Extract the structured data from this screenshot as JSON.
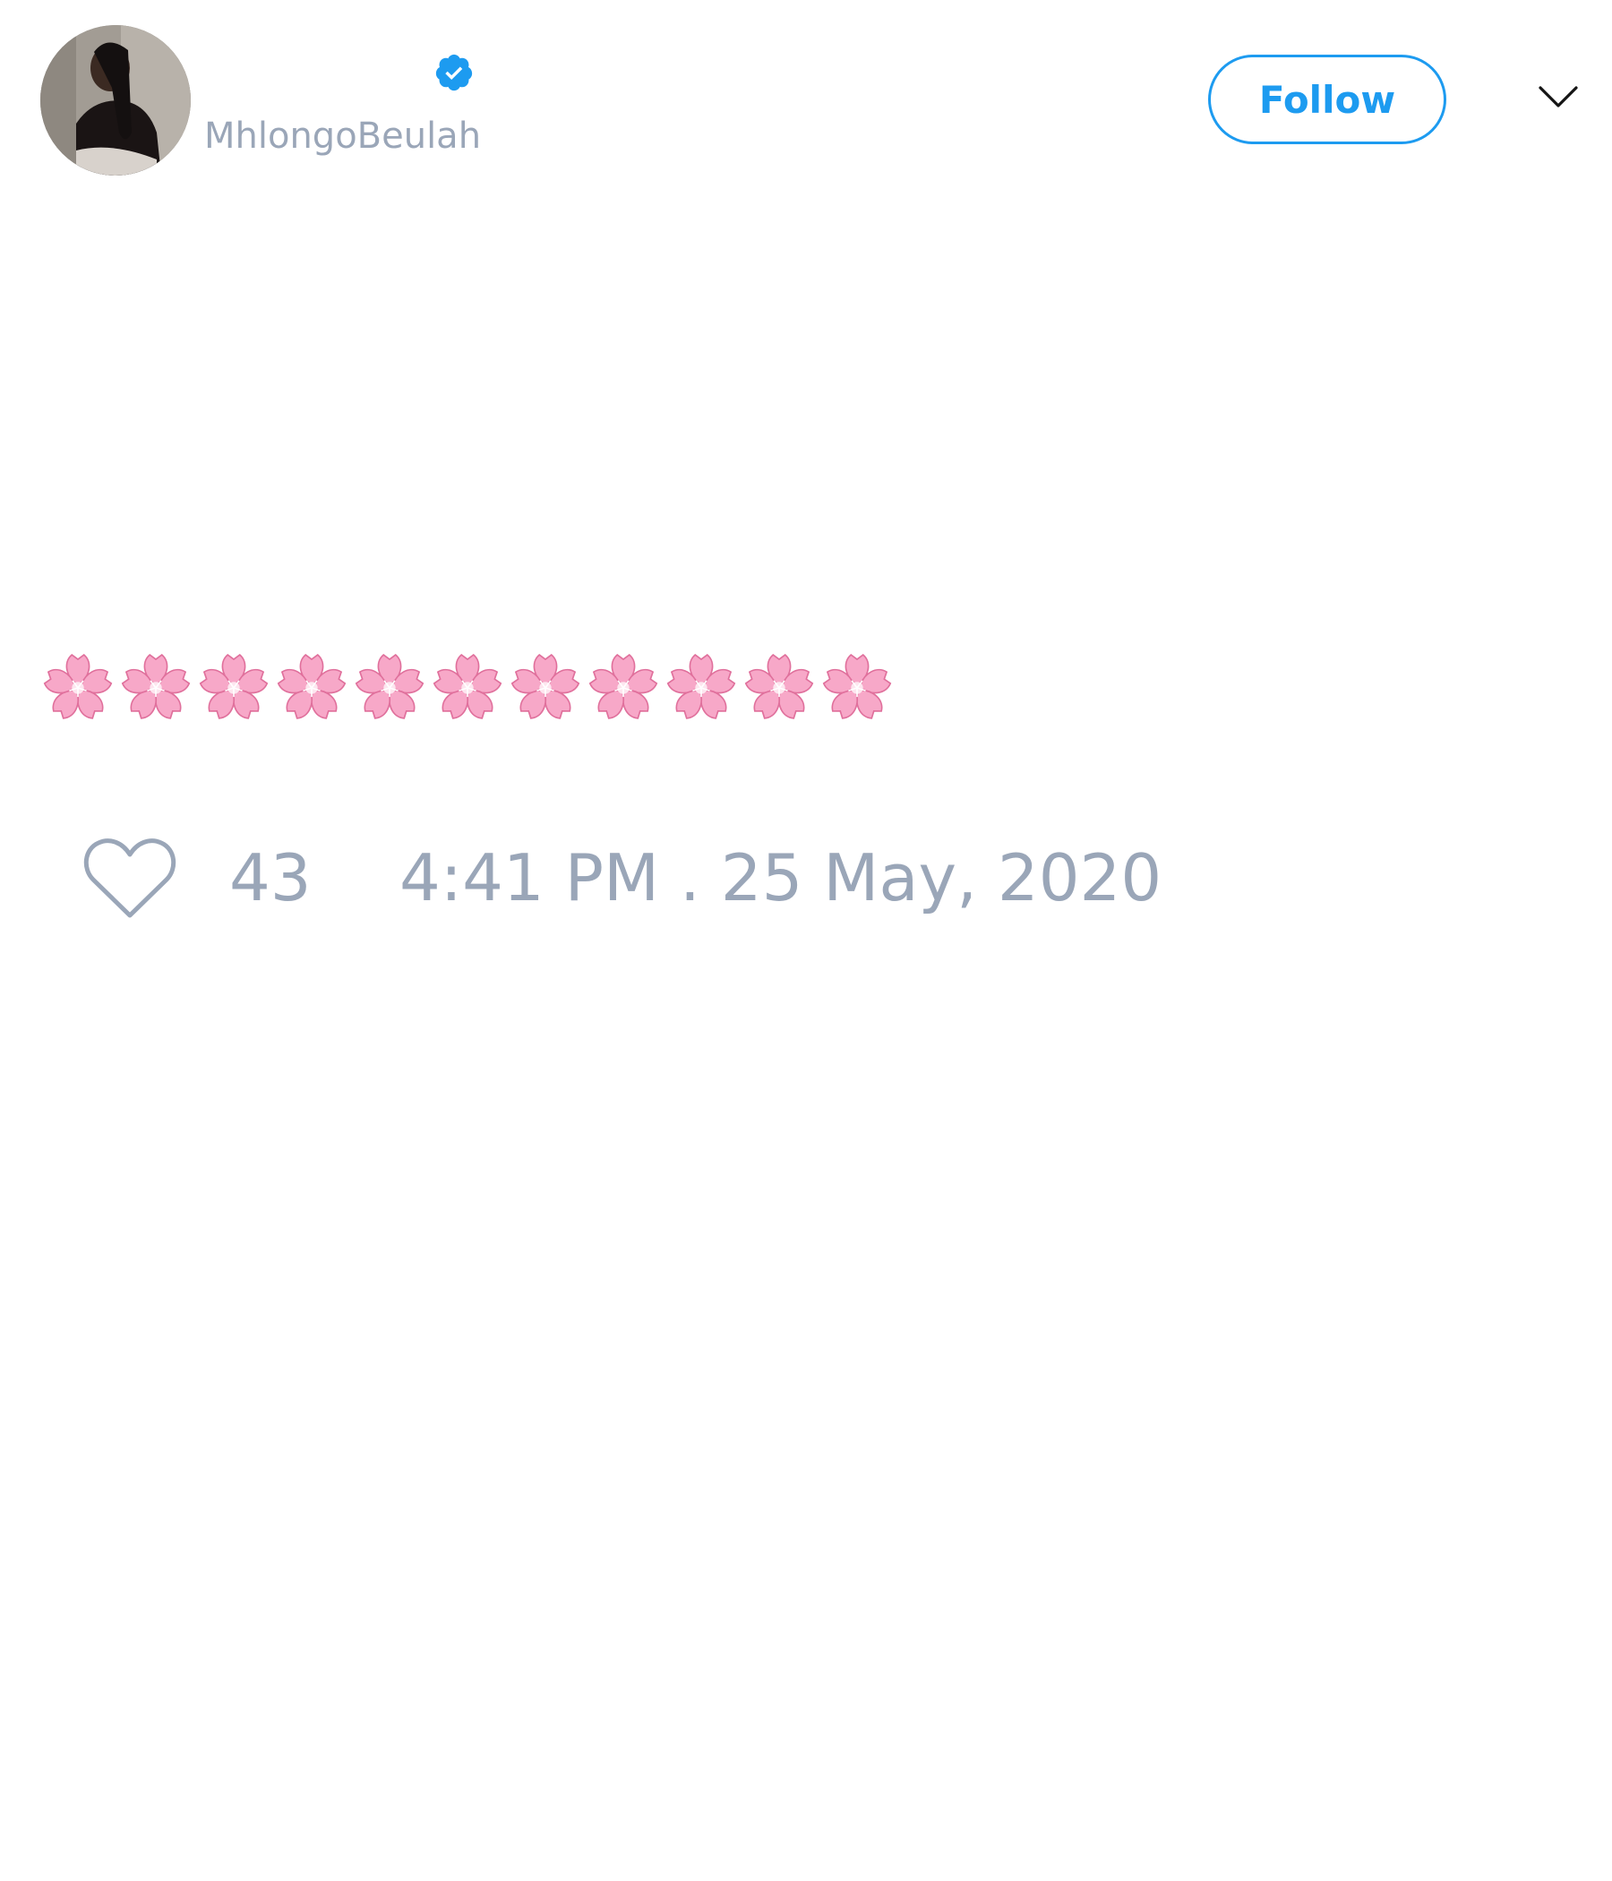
{
  "tweet": {
    "author": {
      "handle": "MhlongoBeulah",
      "verified": true,
      "avatar": "profile-photo"
    },
    "follow_label": "Follow",
    "more_menu_icon": "chevron-down-icon",
    "text_icons": [
      "cherry-blossom-icon",
      "cherry-blossom-icon",
      "cherry-blossom-icon",
      "cherry-blossom-icon",
      "cherry-blossom-icon",
      "cherry-blossom-icon",
      "cherry-blossom-icon",
      "cherry-blossom-icon",
      "cherry-blossom-icon",
      "cherry-blossom-icon",
      "cherry-blossom-icon"
    ],
    "like_icon": "heart-outline-icon",
    "like_count": "43",
    "timestamp": "4:41 PM . 25 May, 2020"
  },
  "colors": {
    "accent": "#1d9bf0",
    "muted_text": "#9aa6b8",
    "blossom_pink": "#f7a8c8"
  }
}
